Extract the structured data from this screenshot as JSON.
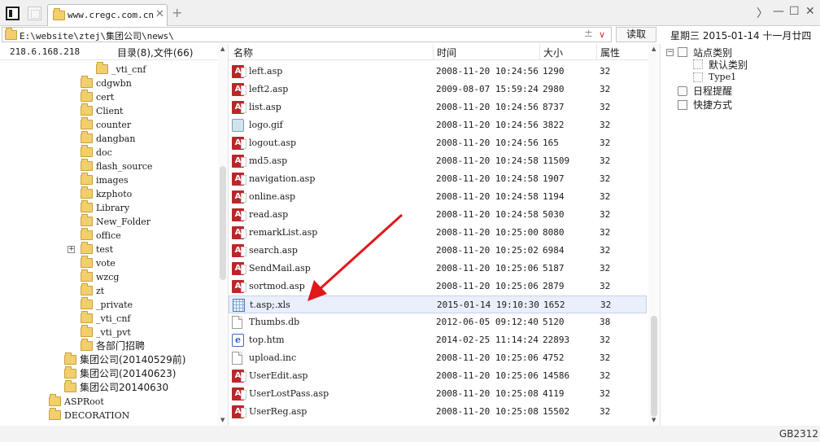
{
  "tab": {
    "title": "www.cregc.com.cn",
    "close": "✕",
    "add": "+"
  },
  "window": {
    "nav": "〉",
    "minimize": "—",
    "maximize": "☐",
    "close": "✕"
  },
  "address": {
    "path": "E:\\website\\ztej\\集团公司\\news\\",
    "plusminus": "±",
    "dropdown": "∨",
    "read_button": "读取"
  },
  "datebar": {
    "weekday": "星期三",
    "date": "2015-01-14",
    "lunar": "十一月廿四"
  },
  "left": {
    "ip": "218.6.168.218",
    "counts": "目录(8),文件(66)",
    "tree": [
      {
        "label": "_vti_cnf",
        "indent": 4,
        "cjk": false
      },
      {
        "label": "cdgwbn",
        "indent": 3,
        "cjk": false
      },
      {
        "label": "cert",
        "indent": 3,
        "cjk": false
      },
      {
        "label": "Client",
        "indent": 3,
        "cjk": false
      },
      {
        "label": "counter",
        "indent": 3,
        "cjk": false
      },
      {
        "label": "dangban",
        "indent": 3,
        "cjk": false
      },
      {
        "label": "doc",
        "indent": 3,
        "cjk": false
      },
      {
        "label": "flash_source",
        "indent": 3,
        "cjk": false
      },
      {
        "label": "images",
        "indent": 3,
        "cjk": false
      },
      {
        "label": "kzphoto",
        "indent": 3,
        "cjk": false
      },
      {
        "label": "Library",
        "indent": 3,
        "cjk": false
      },
      {
        "label": "New_Folder",
        "indent": 3,
        "cjk": false
      },
      {
        "label": "office",
        "indent": 3,
        "cjk": false
      },
      {
        "label": "test",
        "indent": 3,
        "cjk": false,
        "expander": "+"
      },
      {
        "label": "vote",
        "indent": 3,
        "cjk": false
      },
      {
        "label": "wzcg",
        "indent": 3,
        "cjk": false
      },
      {
        "label": "zt",
        "indent": 3,
        "cjk": false
      },
      {
        "label": "_private",
        "indent": 3,
        "cjk": false
      },
      {
        "label": "_vti_cnf",
        "indent": 3,
        "cjk": false
      },
      {
        "label": "_vti_pvt",
        "indent": 3,
        "cjk": false
      },
      {
        "label": "各部门招聘",
        "indent": 3,
        "cjk": true
      },
      {
        "label": "集团公司(20140529前)",
        "indent": 2,
        "cjk": true
      },
      {
        "label": "集团公司(20140623)",
        "indent": 2,
        "cjk": true
      },
      {
        "label": "集团公司20140630",
        "indent": 2,
        "cjk": true
      },
      {
        "label": "ASPRoot",
        "indent": 1,
        "cjk": false
      },
      {
        "label": "DECORATION",
        "indent": 1,
        "cjk": false
      }
    ],
    "scroll_up": "▲",
    "scroll_down": "▼"
  },
  "files": {
    "columns": {
      "name": "名称",
      "time": "时间",
      "size": "大小",
      "attr": "属性"
    },
    "rows": [
      {
        "name": "left.asp",
        "time": "2008-11-20 10:24:56",
        "size": "1290",
        "attr": "32",
        "type": "asp"
      },
      {
        "name": "left2.asp",
        "time": "2009-08-07 15:59:24",
        "size": "2980",
        "attr": "32",
        "type": "asp"
      },
      {
        "name": "list.asp",
        "time": "2008-11-20 10:24:56",
        "size": "8737",
        "attr": "32",
        "type": "asp"
      },
      {
        "name": "logo.gif",
        "time": "2008-11-20 10:24:56",
        "size": "3822",
        "attr": "32",
        "type": "gif"
      },
      {
        "name": "logout.asp",
        "time": "2008-11-20 10:24:56",
        "size": "165",
        "attr": "32",
        "type": "asp"
      },
      {
        "name": "md5.asp",
        "time": "2008-11-20 10:24:58",
        "size": "11509",
        "attr": "32",
        "type": "asp"
      },
      {
        "name": "navigation.asp",
        "time": "2008-11-20 10:24:58",
        "size": "1907",
        "attr": "32",
        "type": "asp"
      },
      {
        "name": "online.asp",
        "time": "2008-11-20 10:24:58",
        "size": "1194",
        "attr": "32",
        "type": "asp"
      },
      {
        "name": "read.asp",
        "time": "2008-11-20 10:24:58",
        "size": "5030",
        "attr": "32",
        "type": "asp"
      },
      {
        "name": "remarkList.asp",
        "time": "2008-11-20 10:25:00",
        "size": "8080",
        "attr": "32",
        "type": "asp"
      },
      {
        "name": "search.asp",
        "time": "2008-11-20 10:25:02",
        "size": "6984",
        "attr": "32",
        "type": "asp"
      },
      {
        "name": "SendMail.asp",
        "time": "2008-11-20 10:25:06",
        "size": "5187",
        "attr": "32",
        "type": "asp"
      },
      {
        "name": "sortmod.asp",
        "time": "2008-11-20 10:25:06",
        "size": "2879",
        "attr": "32",
        "type": "asp"
      },
      {
        "name": "t.asp;.xls",
        "time": "2015-01-14 19:10:30",
        "size": "1652",
        "attr": "32",
        "type": "xls",
        "selected": true
      },
      {
        "name": "Thumbs.db",
        "time": "2012-06-05 09:12:40",
        "size": "5120",
        "attr": "38",
        "type": "doc"
      },
      {
        "name": "top.htm",
        "time": "2014-02-25 11:14:24",
        "size": "22893",
        "attr": "32",
        "type": "htm"
      },
      {
        "name": "upload.inc",
        "time": "2008-11-20 10:25:06",
        "size": "4752",
        "attr": "32",
        "type": "doc"
      },
      {
        "name": "UserEdit.asp",
        "time": "2008-11-20 10:25:06",
        "size": "14586",
        "attr": "32",
        "type": "asp"
      },
      {
        "name": "UserLostPass.asp",
        "time": "2008-11-20 10:25:08",
        "size": "4119",
        "attr": "32",
        "type": "asp"
      },
      {
        "name": "UserReg.asp",
        "time": "2008-11-20 10:25:08",
        "size": "15502",
        "attr": "32",
        "type": "asp"
      }
    ]
  },
  "right": {
    "categories": "站点类别",
    "default_category": "默认类别",
    "type1": "Type1",
    "schedule": "日程提醒",
    "shortcuts": "快捷方式",
    "minus": "−"
  },
  "footer": {
    "encoding": "GB2312"
  },
  "colors": {
    "arrow": "#e0181b",
    "selection": "#e9effb",
    "asp_icon": "#b8282a",
    "folder": "#f2cf6c"
  },
  "icons": {
    "asp": "asp-file-icon",
    "gif": "image-file-icon",
    "xls": "spreadsheet-file-icon",
    "doc": "generic-file-icon",
    "htm": "html-file-icon",
    "folder": "folder-icon"
  }
}
